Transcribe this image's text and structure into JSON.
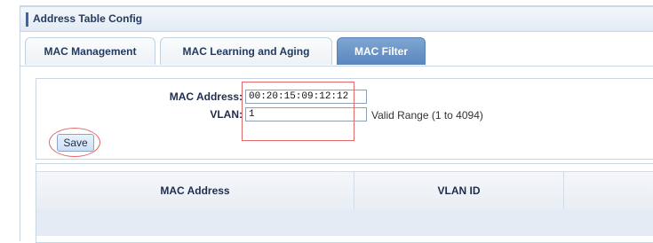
{
  "window": {
    "title": "Address Table Config"
  },
  "tabs": [
    {
      "label": "MAC Management",
      "active": false
    },
    {
      "label": "MAC Learning and Aging",
      "active": false
    },
    {
      "label": "MAC Filter",
      "active": true
    }
  ],
  "form": {
    "mac_address": {
      "label": "MAC Address:",
      "value": "00:20:15:09:12:12"
    },
    "vlan": {
      "label": "VLAN:",
      "value": "1",
      "hint": "Valid Range (1 to 4094)"
    },
    "save_label": "Save"
  },
  "table": {
    "columns": [
      "MAC Address",
      "VLAN ID",
      ""
    ],
    "rows": []
  },
  "colors": {
    "accent": "#5a86bd",
    "annotation": "#e06a6a"
  }
}
